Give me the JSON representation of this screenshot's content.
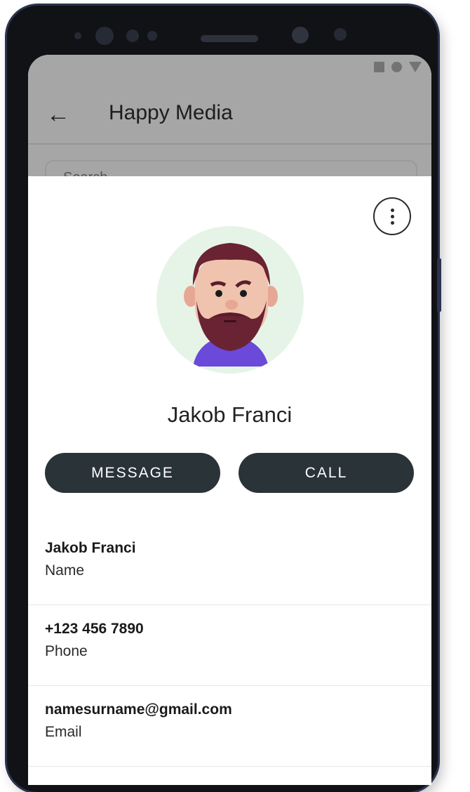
{
  "app_bar": {
    "title": "Happy Media",
    "back_icon": "←",
    "search_hint": "Search"
  },
  "contact": {
    "name": "Jakob Franci",
    "more_icon": "more-vert-icon"
  },
  "actions": {
    "message_label": "MESSAGE",
    "call_label": "CALL"
  },
  "fields": [
    {
      "value": "Jakob Franci",
      "label": "Name"
    },
    {
      "value": "+123 456 7890",
      "label": "Phone"
    },
    {
      "value": "namesurname@gmail.com",
      "label": "Email"
    }
  ],
  "colors": {
    "button_bg": "#2a3338",
    "avatar_bg": "#e6f4e7",
    "scrim": "#a6a6a6"
  }
}
